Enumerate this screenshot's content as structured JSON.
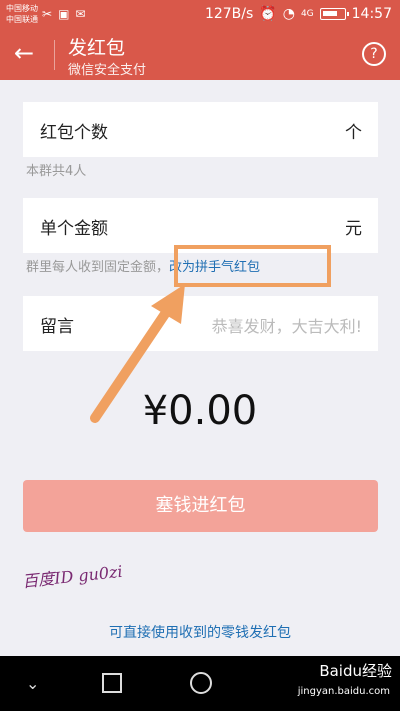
{
  "status": {
    "carrier1": "中国移动",
    "carrier2": "中国联通",
    "speed": "127B/s",
    "net": "4G",
    "time": "14:57"
  },
  "appbar": {
    "title": "发红包",
    "subtitle": "微信安全支付",
    "help": "?"
  },
  "form": {
    "count_label": "红包个数",
    "count_unit": "个",
    "count_hint": "本群共4人",
    "amount_label": "单个金额",
    "amount_unit": "元",
    "amount_hint": "群里每人收到固定金额，",
    "amount_link": "改为拼手气红包",
    "msg_label": "留言",
    "msg_placeholder": "恭喜发财，大吉大利!"
  },
  "total": "¥0.00",
  "submit": "塞钱进红包",
  "watermark": "百度ID gu0zi",
  "bottom_link": "可直接使用收到的零钱发红包",
  "jingyan": {
    "brand": "Baidu经验",
    "url": "jingyan.baidu.com"
  }
}
